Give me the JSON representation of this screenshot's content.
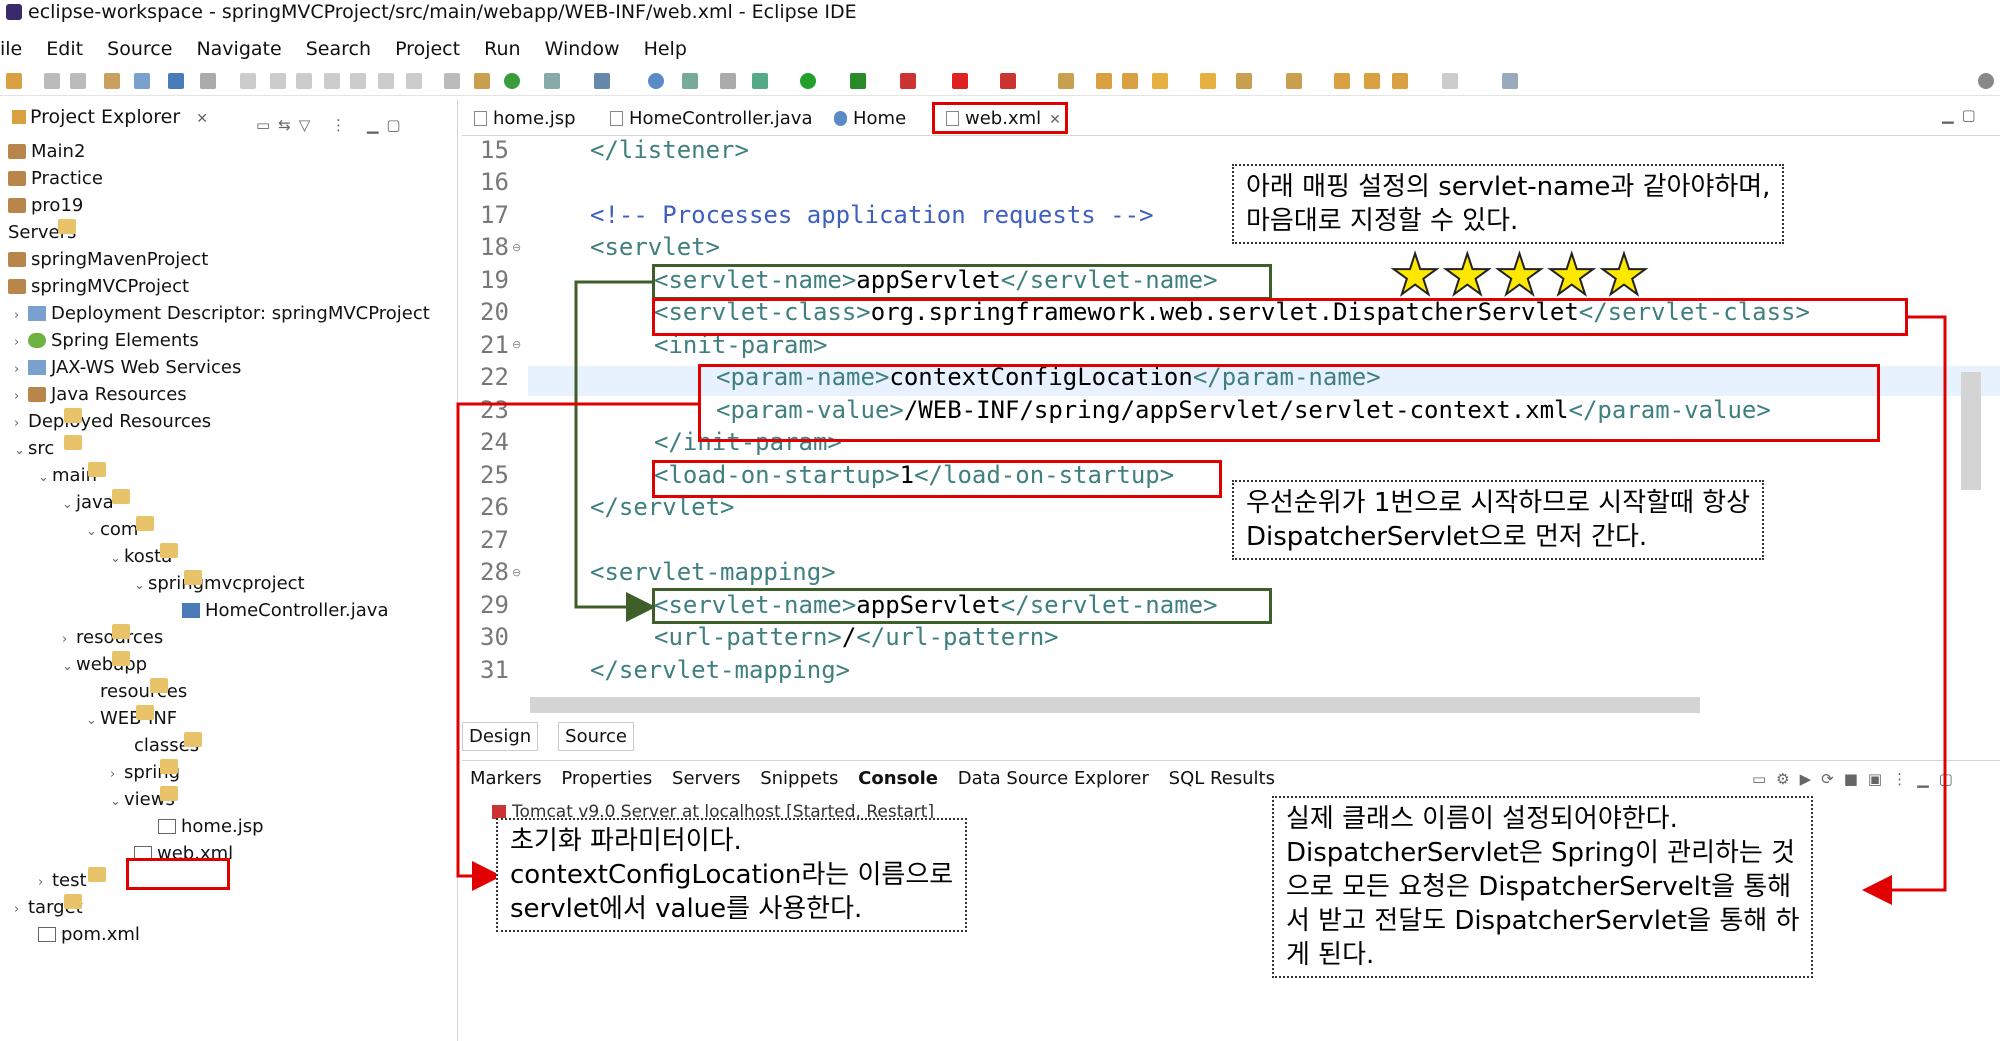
{
  "window": {
    "title": "eclipse-workspace - springMVCProject/src/main/webapp/WEB-INF/web.xml - Eclipse IDE"
  },
  "menu": [
    "ile",
    "Edit",
    "Source",
    "Navigate",
    "Search",
    "Project",
    "Run",
    "Window",
    "Help"
  ],
  "project_explorer": {
    "title": "Project Explorer",
    "items": [
      {
        "label": "Main2"
      },
      {
        "label": "Practice"
      },
      {
        "label": "pro19"
      },
      {
        "label": "Servers"
      },
      {
        "label": "springMavenProject"
      },
      {
        "label": "springMVCProject"
      },
      {
        "label": "Deployment Descriptor: springMVCProject"
      },
      {
        "label": "Spring Elements"
      },
      {
        "label": "JAX-WS Web Services"
      },
      {
        "label": "Java Resources"
      },
      {
        "label": "Deployed Resources"
      },
      {
        "label": "src"
      },
      {
        "label": "main"
      },
      {
        "label": "java"
      },
      {
        "label": "com"
      },
      {
        "label": "kosta"
      },
      {
        "label": "springmvcproject"
      },
      {
        "label": "HomeController.java"
      },
      {
        "label": "resources"
      },
      {
        "label": "webapp"
      },
      {
        "label": "resources"
      },
      {
        "label": "WEB-INF"
      },
      {
        "label": "classes"
      },
      {
        "label": "spring"
      },
      {
        "label": "views"
      },
      {
        "label": "home.jsp"
      },
      {
        "label": "web.xml"
      },
      {
        "label": "test"
      },
      {
        "label": "target"
      },
      {
        "label": "pom.xml"
      }
    ]
  },
  "editor": {
    "tabs": [
      {
        "label": "home.jsp"
      },
      {
        "label": "HomeController.java"
      },
      {
        "label": "Home"
      },
      {
        "label": "web.xml"
      }
    ],
    "line_numbers": [
      "15",
      "16",
      "17",
      "18",
      "19",
      "20",
      "21",
      "22",
      "23",
      "24",
      "25",
      "26",
      "27",
      "28",
      "29",
      "30",
      "31"
    ],
    "lines": [
      {
        "tag_open": "</listener>",
        "text": "",
        "tag_close": ""
      },
      {
        "tag_open": "",
        "text": "",
        "tag_close": ""
      },
      {
        "comment": "<!-- Processes application requests -->"
      },
      {
        "tag_open": "<servlet>",
        "text": "",
        "tag_close": ""
      },
      {
        "tag_open": "<servlet-name>",
        "text": "appServlet",
        "tag_close": "</servlet-name>"
      },
      {
        "tag_open": "<servlet-class>",
        "text": "org.springframework.web.servlet.DispatcherServlet",
        "tag_close": "</servlet-class>"
      },
      {
        "tag_open": "<init-param>",
        "text": "",
        "tag_close": ""
      },
      {
        "tag_open": "<param-name>",
        "text": "contextConfigLocation",
        "tag_close": "</param-name>"
      },
      {
        "tag_open": "<param-value>",
        "text": "/WEB-INF/spring/appServlet/servlet-context.xml",
        "tag_close": "</param-value>"
      },
      {
        "tag_open": "</init-param>",
        "text": "",
        "tag_close": ""
      },
      {
        "tag_open": "<load-on-startup>",
        "text": "1",
        "tag_close": "</load-on-startup>"
      },
      {
        "tag_open": "</servlet>",
        "text": "",
        "tag_close": ""
      },
      {
        "tag_open": "",
        "text": "",
        "tag_close": ""
      },
      {
        "tag_open": "<servlet-mapping>",
        "text": "",
        "tag_close": ""
      },
      {
        "tag_open": "<servlet-name>",
        "text": "appServlet",
        "tag_close": "</servlet-name>"
      },
      {
        "tag_open": "<url-pattern>",
        "text": "/",
        "tag_close": "</url-pattern>"
      },
      {
        "tag_open": "</servlet-mapping>",
        "text": "",
        "tag_close": ""
      }
    ],
    "bottom_tabs": {
      "design": "Design",
      "source": "Source"
    }
  },
  "console_panel": {
    "tabs": [
      "Markers",
      "Properties",
      "Servers",
      "Snippets",
      "Console",
      "Data Source Explorer",
      "SQL Results"
    ],
    "server_row": "Tomcat v9.0 Server at localhost  [Started, Restart]"
  },
  "annotations": {
    "note_top_1": "아래 매핑 설정의 servlet-name과 같아야하며,",
    "note_top_2": "마음대로 지정할 수 있다.",
    "note_mid_1": "우선순위가 1번으로 시작하므로 시작할때 항상",
    "note_mid_2": "DispatcherServlet으로 먼저 간다.",
    "note_left_1": "초기화 파라미터이다.",
    "note_left_2": "contextConfigLocation라는 이름으로",
    "note_left_3": "servlet에서 value를 사용한다.",
    "note_right_1": "실제 클래스 이름이 설정되어야한다.",
    "note_right_2": "DispatcherServlet은 Spring이 관리하는 것",
    "note_right_3": "으로 모든 요청은 DispatcherServelt을 통해",
    "note_right_4": "서 받고 전달도 DispatcherServlet을 통해 하",
    "note_right_5": "게 된다.",
    "stars": "★★★★★"
  },
  "colors": {
    "highlight_red": "#e00000",
    "highlight_green": "#3f5f2a",
    "star_yellow": "#ffe800",
    "tag_teal": "#3f7f7f",
    "comment_blue": "#3f5fbf"
  }
}
